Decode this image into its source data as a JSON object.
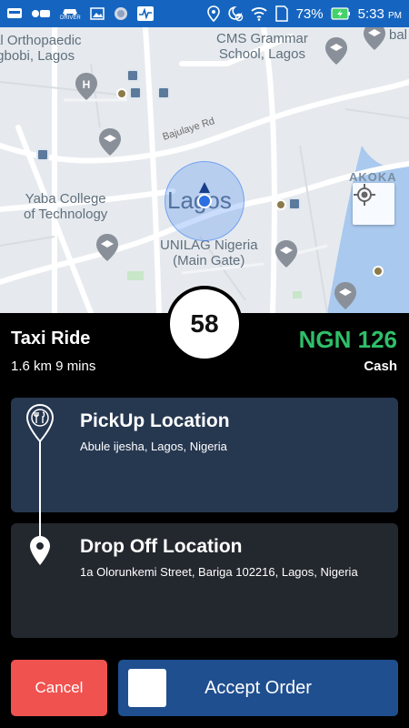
{
  "status_bar": {
    "battery": "73%",
    "time": "5:33",
    "time_suffix": "PM",
    "app_badge": "DRIVER",
    "colors": {
      "background": "#1565c0"
    }
  },
  "map": {
    "labels": {
      "orthopaedic": "al Orthopaedic\nIgbobi, Lagos",
      "cms": "CMS Grammar\nSchool, Lagos",
      "bajulaye": "Bajulaye Rd",
      "yaba": "Yaba College\nof Technology",
      "lagos": "Lagos",
      "unilag": "UNILAG Nigeria\n(Main Gate)",
      "akoka": "AKOKA",
      "bal": "bal"
    }
  },
  "ride": {
    "timer": "58",
    "type": "Taxi Ride",
    "meta": "1.6 km 9 mins",
    "price": "NGN 126",
    "payment": "Cash",
    "colors": {
      "price": "#2fbf6a"
    }
  },
  "pickup": {
    "title": "PickUp Location",
    "address": "Abule ijesha, Lagos, Nigeria",
    "icon": "pickup-marker-icon",
    "color": "#263750"
  },
  "dropoff": {
    "title": "Drop Off Location",
    "address": "1a Olorunkemi Street, Bariga 102216, Lagos, Nigeria",
    "icon": "location-pin-icon",
    "color": "#23272e"
  },
  "actions": {
    "cancel_label": "Cancel",
    "accept_label": "Accept Order",
    "colors": {
      "cancel": "#f0524f",
      "accept": "#1f4f8f"
    }
  }
}
